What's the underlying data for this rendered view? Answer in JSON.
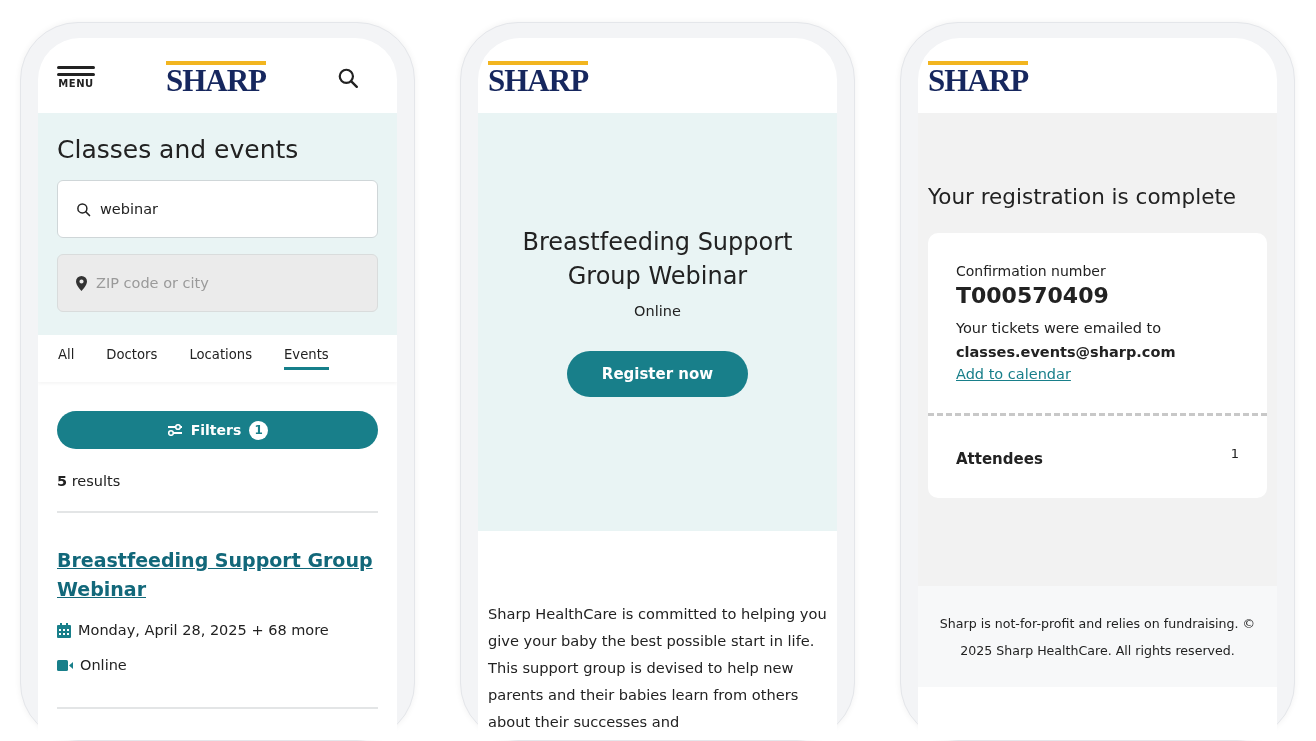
{
  "search_screen": {
    "menu_label": "MENU",
    "logo": "SHARP",
    "title": "Classes and events",
    "search": {
      "value": "webinar"
    },
    "location": {
      "placeholder": "ZIP code or city"
    },
    "tabs": [
      {
        "label": "All",
        "selected": false
      },
      {
        "label": "Doctors",
        "selected": false
      },
      {
        "label": "Locations",
        "selected": false
      },
      {
        "label": "Events",
        "selected": true
      }
    ],
    "filters": {
      "label": "Filters",
      "count": "1"
    },
    "results": "**5** results",
    "items": [
      {
        "title": "Breastfeeding Support Group Webinar",
        "date": "Monday, April 28, 2025 + 68 more",
        "location": "Online"
      }
    ]
  },
  "event_screen": {
    "logo": "SHARP",
    "title": "Breastfeeding Support Group Webinar",
    "location": "Online",
    "button": "Register now",
    "description": "Sharp HealthCare is committed to helping you give your baby the best possible start in life. This support group is devised to help new parents and their babies learn from others about their successes and"
  },
  "confirmation_screen": {
    "logo": "SHARP",
    "title": "Your registration is complete",
    "confirmation_label": "Confirmation number",
    "confirmation_number": "T000570409",
    "emailed_label": "Your tickets were emailed to",
    "email": "classes.events@sharp.com",
    "calendar_link": "Add to calendar",
    "attendees_label": "Attendees",
    "attendees_count": "1",
    "footer": "Sharp is not-for-profit and relies on fundraising. © 2025 Sharp HealthCare. All rights reserved."
  }
}
